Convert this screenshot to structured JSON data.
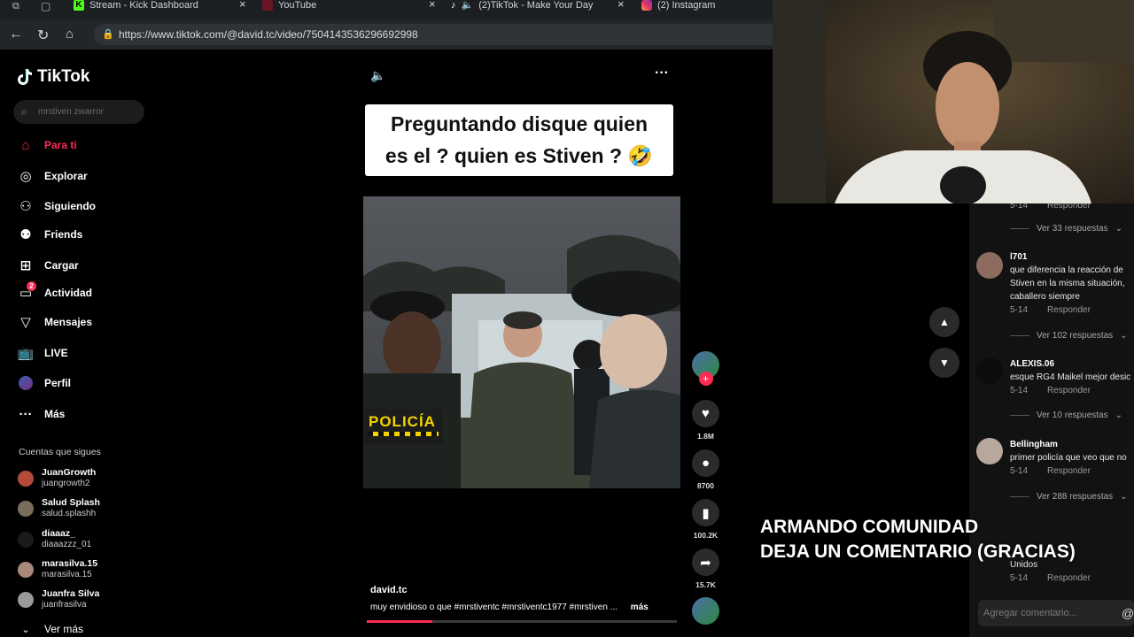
{
  "browser": {
    "tabs": [
      {
        "label": "Stream - Kick Dashboard",
        "color": "#53fc18",
        "icon": "kick-icon"
      },
      {
        "label": "YouTube",
        "color": "#ff0033",
        "icon": "youtube-icon"
      },
      {
        "label": "(2)TikTok - Make Your Day",
        "color": "#ffffff",
        "icon": "tiktok-icon"
      },
      {
        "label": "(2) Instagram",
        "color": "#e1306c",
        "icon": "instagram-icon"
      }
    ],
    "url": "https://www.tiktok.com/@david.tc/video/7504143536296692998"
  },
  "sidebar": {
    "logo": "TikTok",
    "search_placeholder": "mrstiven zwarror",
    "menu": [
      {
        "label": "Para ti",
        "icon": "home-icon",
        "active": true
      },
      {
        "label": "Explorar",
        "icon": "compass-icon"
      },
      {
        "label": "Siguiendo",
        "icon": "following-icon"
      },
      {
        "label": "Friends",
        "icon": "friends-icon"
      },
      {
        "label": "Cargar",
        "icon": "upload-icon"
      },
      {
        "label": "Actividad",
        "icon": "activity-icon",
        "badge": "2"
      },
      {
        "label": "Mensajes",
        "icon": "messages-icon"
      },
      {
        "label": "LIVE",
        "icon": "live-icon"
      },
      {
        "label": "Perfil",
        "icon": "profile-icon"
      },
      {
        "label": "Más",
        "icon": "more-icon"
      }
    ],
    "following_title": "Cuentas que sigues",
    "accounts": [
      {
        "name": "JuanGrowth",
        "handle": "juangrowth2"
      },
      {
        "name": "Salud Splash",
        "handle": "salud.splashh"
      },
      {
        "name": "diaaaz_",
        "handle": "diaaazzz_01"
      },
      {
        "name": "marasilva.15",
        "handle": "marasilva.15"
      },
      {
        "name": "Juanfra Silva",
        "handle": "juanfrasilva"
      }
    ],
    "see_more": "Ver más"
  },
  "video": {
    "caption_line1": "Preguntando disque quien",
    "caption_line2": "es el ? quien es Stiven ? 🤣",
    "author": "david.tc",
    "description": "muy envidioso o que  #mrstiventc  #mrstiventc1977  #mrstiven  ...",
    "more": "más",
    "badge_text": "POLICÍA",
    "progress": 0.21
  },
  "actions": {
    "likes": "1.8M",
    "comments": "8700",
    "saves": "100.2K",
    "shares": "15.7K"
  },
  "comments": {
    "top_meta_date": "5-14",
    "reply_label": "Responder",
    "items": [
      {
        "view_replies": "Ver 33 respuestas"
      },
      {
        "name": "l701",
        "lines": [
          "que diferencia la reacción de",
          "Stiven en la misma situación,",
          "caballero siempre"
        ],
        "date": "5-14",
        "view_replies": "Ver 102 respuestas"
      },
      {
        "name": "ALEXIS.06",
        "lines": [
          "esque RG4 Maikel mejor desic"
        ],
        "date": "5-14",
        "view_replies": "Ver 10 respuestas"
      },
      {
        "name": "Bellingham",
        "lines": [
          "primer policía que veo que no"
        ],
        "date": "5-14",
        "view_replies": "Ver 288 respuestas"
      },
      {
        "name": "",
        "lines": [
          "Unidos"
        ],
        "date": "5-14"
      }
    ],
    "add_placeholder": "Agregar comentario..."
  },
  "overlay": {
    "line1": "ARMANDO COMUNIDAD",
    "line2": "DEJA UN COMENTARIO (GRACIAS)"
  },
  "colors": {
    "accent": "#fe2c55",
    "background": "#000000"
  }
}
